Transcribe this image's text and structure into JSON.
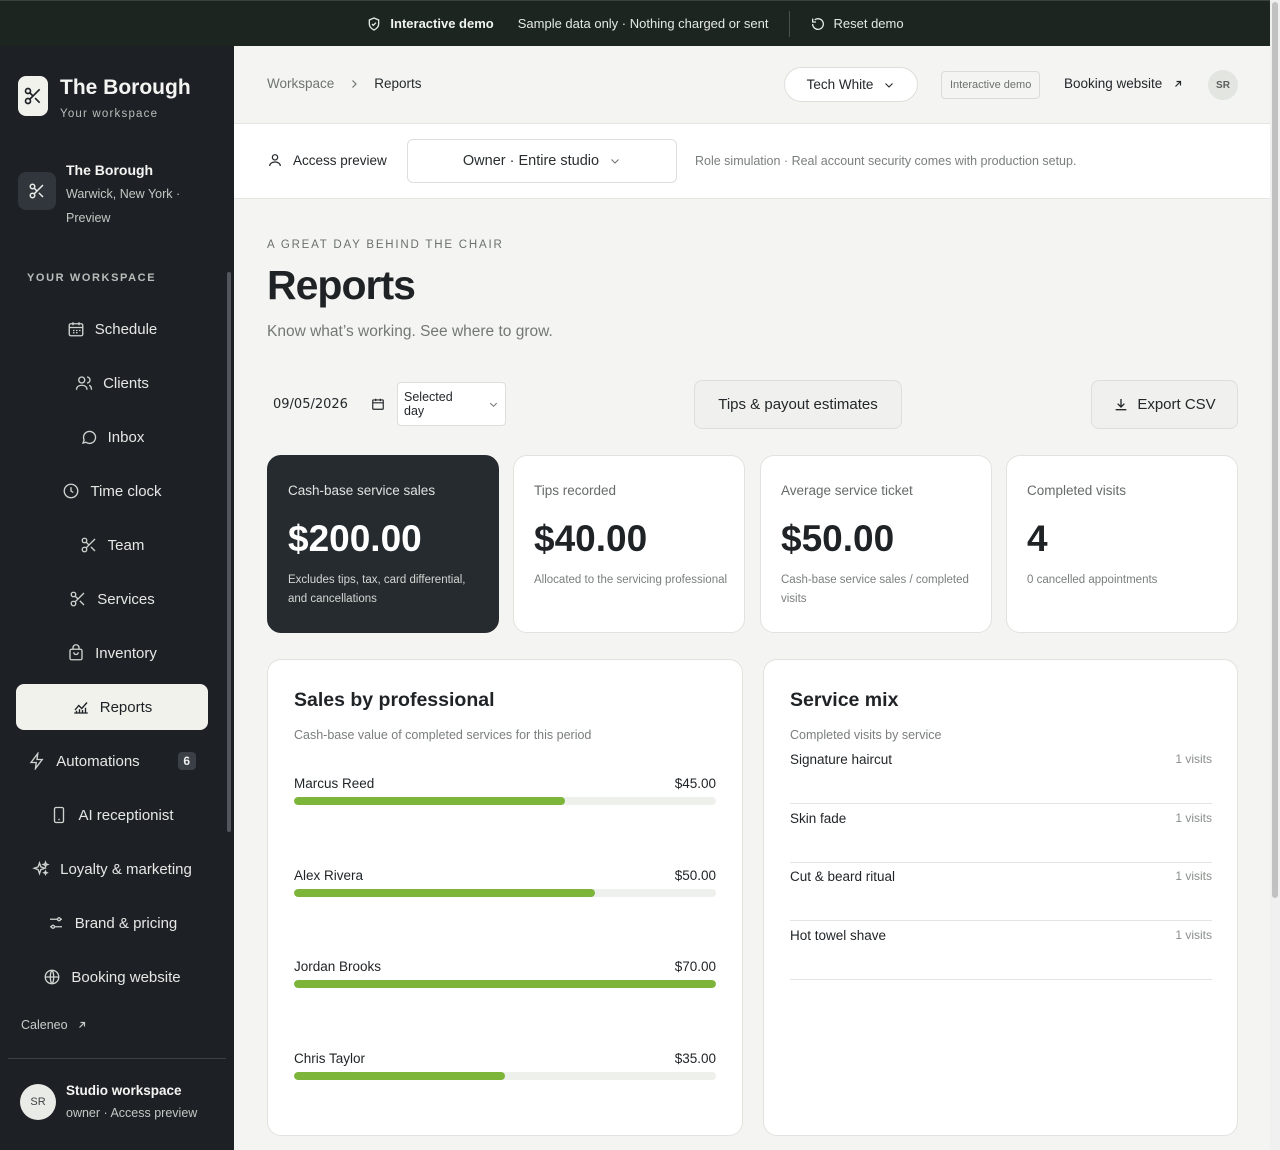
{
  "demo_bar": {
    "title": "Interactive demo",
    "note": "Sample data only · Nothing charged or sent",
    "reset": "Reset demo"
  },
  "sidebar": {
    "brand_name": "The Borough",
    "brand_sub": "Your workspace",
    "studio_name": "The Borough",
    "studio_location": "Warwick, New York · Preview",
    "section_label": "YOUR WORKSPACE",
    "items": [
      {
        "label": "Schedule",
        "icon": "calendar-icon"
      },
      {
        "label": "Clients",
        "icon": "users-icon"
      },
      {
        "label": "Inbox",
        "icon": "chat-bubble-icon"
      },
      {
        "label": "Time clock",
        "icon": "clock-icon"
      },
      {
        "label": "Team",
        "icon": "scissors-icon"
      },
      {
        "label": "Services",
        "icon": "scissors-icon"
      },
      {
        "label": "Inventory",
        "icon": "shopping-bag-icon"
      },
      {
        "label": "Reports",
        "icon": "chart-line-icon",
        "active": true
      },
      {
        "label": "Automations",
        "icon": "lightning-icon",
        "badge": "6"
      },
      {
        "label": "AI receptionist",
        "icon": "phone-icon"
      },
      {
        "label": "Loyalty & marketing",
        "icon": "sparkles-icon"
      },
      {
        "label": "Brand & pricing",
        "icon": "sliders-icon"
      },
      {
        "label": "Booking website",
        "icon": "globe-icon"
      }
    ],
    "caleneo_link": "Caleneo",
    "user_initials": "SR",
    "user_name": "Studio workspace",
    "user_role": "owner · Access preview"
  },
  "header": {
    "breadcrumb_root": "Workspace",
    "breadcrumb_current": "Reports",
    "theme_select": "Tech White",
    "demo_chip": "Interactive demo",
    "booking_link": "Booking website",
    "avatar_initials": "SR"
  },
  "access": {
    "label": "Access preview",
    "role_select": "Owner · Entire studio",
    "note": "Role simulation · Real account security comes with production setup."
  },
  "page": {
    "eyebrow": "A GREAT DAY BEHIND THE CHAIR",
    "title": "Reports",
    "subtitle": "Know what’s working. See where to grow."
  },
  "toolbar": {
    "date_value": "09/05/2026",
    "period_select": "Selected day",
    "tips_button": "Tips & payout estimates",
    "export_button": "Export CSV"
  },
  "kpis": [
    {
      "label": "Cash-base service sales",
      "value": "$200.00",
      "note": "Excludes tips, tax, card differential, and cancellations"
    },
    {
      "label": "Tips recorded",
      "value": "$40.00",
      "note": "Allocated to the servicing professional"
    },
    {
      "label": "Average service ticket",
      "value": "$50.00",
      "note": "Cash-base service sales / completed visits"
    },
    {
      "label": "Completed visits",
      "value": "4",
      "note": "0 cancelled appointments"
    }
  ],
  "sales_by_professional": {
    "title": "Sales by professional",
    "subtitle": "Cash-base value of completed services for this period",
    "rows": [
      {
        "name": "Marcus Reed",
        "value": "$45.00",
        "amount": 45
      },
      {
        "name": "Alex Rivera",
        "value": "$50.00",
        "amount": 50
      },
      {
        "name": "Jordan Brooks",
        "value": "$70.00",
        "amount": 70
      },
      {
        "name": "Chris Taylor",
        "value": "$35.00",
        "amount": 35
      }
    ],
    "bar_color": "#7cb53a"
  },
  "service_mix": {
    "title": "Service mix",
    "subtitle": "Completed visits by service",
    "rows": [
      {
        "name": "Signature haircut",
        "count": "1 visits"
      },
      {
        "name": "Skin fade",
        "count": "1 visits"
      },
      {
        "name": "Cut & beard ritual",
        "count": "1 visits"
      },
      {
        "name": "Hot towel shave",
        "count": "1 visits"
      }
    ]
  }
}
